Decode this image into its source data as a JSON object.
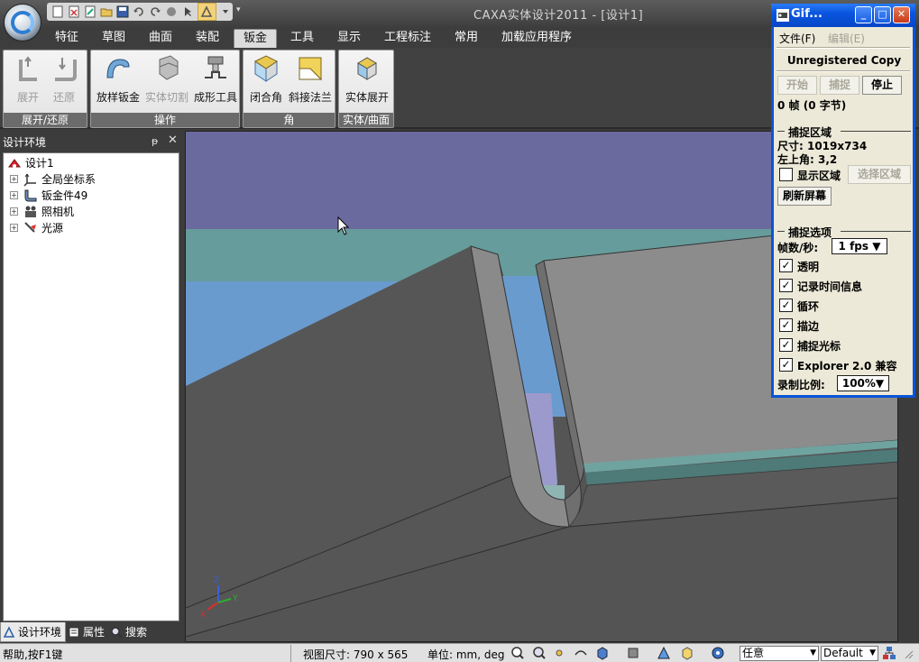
{
  "window": {
    "title": "CAXA实体设计2011 - [设计1]"
  },
  "quick_access": {
    "more_glyph": "▾"
  },
  "ribbon": {
    "tabs": [
      "特征",
      "草图",
      "曲面",
      "装配",
      "钣金",
      "工具",
      "显示",
      "工程标注",
      "常用",
      "加载应用程序"
    ],
    "active_tab": "钣金",
    "groups": [
      {
        "caption": "展开/还原",
        "buttons": [
          "展开",
          "还原"
        ]
      },
      {
        "caption": "操作",
        "buttons": [
          "放样钣金",
          "实体切割",
          "成形工具"
        ]
      },
      {
        "caption": "角",
        "buttons": [
          "闭合角",
          "斜接法兰"
        ]
      },
      {
        "caption": "实体/曲面",
        "buttons": [
          "实体展开"
        ]
      }
    ]
  },
  "left_panel": {
    "title": "设计环境",
    "pin_glyph": "ᵽ",
    "close_glyph": "✕",
    "tree": {
      "root": "设计1",
      "items": [
        "全局坐标系",
        "钣金件49",
        "照相机",
        "光源"
      ]
    },
    "tabs": [
      "设计环境",
      "属性",
      "搜索"
    ]
  },
  "viewport": {
    "axis_labels": {
      "z": "Z",
      "x": "X",
      "y": "Y"
    }
  },
  "statusbar": {
    "help_text": "帮助,按F1键",
    "view_size": "视图尺寸:  790 x  565",
    "units": "单位: mm, deg",
    "filter_value": "任意",
    "style_value": "Default"
  },
  "gif_window": {
    "title": "Gif...",
    "menu": {
      "file": "文件(F)",
      "edit": "编辑(E)"
    },
    "unregistered": "Unregistered Copy",
    "buttons": {
      "start": "开始",
      "capture": "捕捉",
      "stop": "停止"
    },
    "frames": "0 帧 (0 字节)",
    "capture_area": {
      "heading": "捕捉区域",
      "size": "尺寸: 1019x734",
      "top_left": "左上角: 3,2",
      "show_area": "显示区域",
      "select_area": "选择区域",
      "refresh": "刷新屏幕"
    },
    "capture_options": {
      "heading": "捕捉选项",
      "fps_label": "帧数/秒:",
      "fps_value": "1 fps",
      "options": [
        "透明",
        "记录时间信息",
        "循环",
        "描边",
        "捕捉光标",
        "Explorer 2.0 兼容"
      ],
      "scale_label": "录制比例:",
      "scale_value": "100%"
    }
  },
  "colors": {
    "accent_blue": "#0a54d8",
    "viewport_sky_purple": "#6b6a9f",
    "viewport_teal": "#669c9c",
    "viewport_blue": "#6a9bce",
    "sheet_metal": "#555555"
  }
}
